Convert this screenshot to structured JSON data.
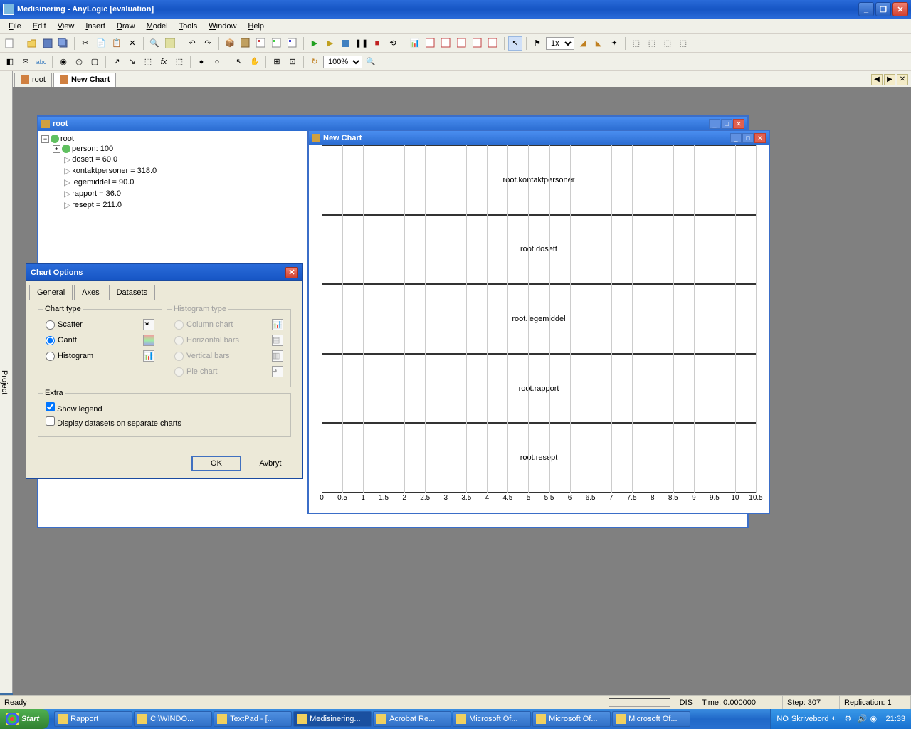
{
  "title": "Medisinering - AnyLogic [evaluation]",
  "menu": [
    "File",
    "Edit",
    "View",
    "Insert",
    "Draw",
    "Model",
    "Tools",
    "Window",
    "Help"
  ],
  "tabs": [
    {
      "label": "root",
      "active": false
    },
    {
      "label": "New Chart",
      "active": true
    }
  ],
  "sidebar_label": "Project",
  "zoom": "100%",
  "speed": "1x",
  "root_window": {
    "title": "root",
    "tree": {
      "root": "root",
      "items": [
        "person: 100",
        "dosett = 60.0",
        "kontaktpersoner = 318.0",
        "legemiddel = 90.0",
        "rapport = 36.0",
        "resept = 211.0"
      ]
    }
  },
  "chart_window": {
    "title": "New Chart",
    "rows": [
      "root.kontaktpersoner",
      "root.dosett",
      "root.legemiddel",
      "root.rapport",
      "root.resept"
    ],
    "xticks": [
      "0",
      "0.5",
      "1",
      "1.5",
      "2",
      "2.5",
      "3",
      "3.5",
      "4",
      "4.5",
      "5",
      "5.5",
      "6",
      "6.5",
      "7",
      "7.5",
      "8",
      "8.5",
      "9",
      "9.5",
      "10",
      "10.5"
    ]
  },
  "dialog": {
    "title": "Chart Options",
    "tabs": [
      "General",
      "Axes",
      "Datasets"
    ],
    "groups": {
      "chart_type": {
        "title": "Chart type",
        "options": [
          "Scatter",
          "Gantt",
          "Histogram"
        ],
        "selected": "Gantt"
      },
      "histogram_type": {
        "title": "Histogram type",
        "options": [
          "Column chart",
          "Horizontal bars",
          "Vertical bars",
          "Pie chart"
        ]
      },
      "extra": {
        "title": "Extra",
        "show_legend": "Show legend",
        "separate": "Display datasets on separate charts",
        "show_legend_checked": true,
        "separate_checked": false
      }
    },
    "buttons": {
      "ok": "OK",
      "cancel": "Avbryt"
    }
  },
  "chart_data": {
    "type": "bar",
    "title": "New Chart",
    "categories": [
      "root.kontaktpersoner",
      "root.dosett",
      "root.legemiddel",
      "root.rapport",
      "root.resept"
    ],
    "values": [
      0,
      0,
      0,
      0,
      0
    ],
    "xlabel": "",
    "ylabel": "",
    "xlim": [
      0,
      10.5
    ]
  },
  "statusbar": {
    "ready": "Ready",
    "dis": "DIS",
    "time": "Time: 0.000000",
    "step": "Step: 307",
    "replication": "Replication: 1"
  },
  "taskbar": {
    "start": "Start",
    "buttons": [
      "Rapport",
      "C:\\WINDO...",
      "TextPad - [...",
      "Medisinering...",
      "Acrobat Re...",
      "Microsoft Of...",
      "Microsoft Of...",
      "Microsoft Of..."
    ],
    "active_index": 3,
    "tray": {
      "lang": "NO",
      "desk": "Skrivebord",
      "clock": "21:33"
    }
  }
}
